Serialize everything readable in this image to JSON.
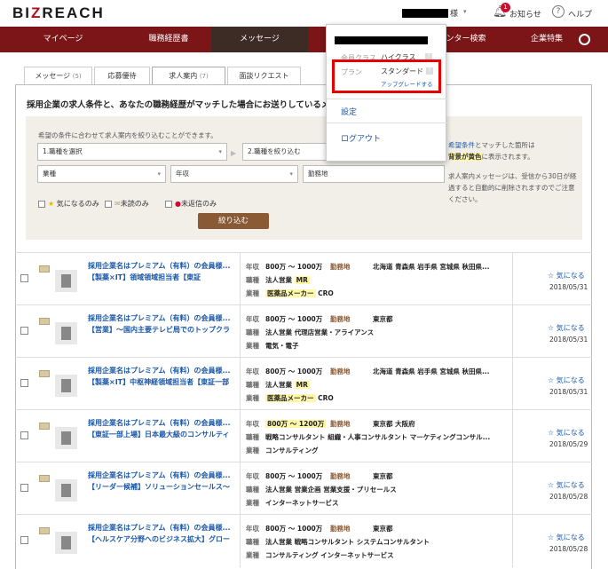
{
  "header": {
    "logo": "BIZREACH",
    "user_suffix": "様",
    "notifications_label": "お知らせ",
    "notifications_count": "1",
    "help_label": "ヘルプ"
  },
  "nav": {
    "items": [
      "マイページ",
      "職務経歴書",
      "メッセージ",
      "",
      "ンター検索",
      "企業特集"
    ],
    "active_index": 2
  },
  "tabs": [
    {
      "label": "メッセージ",
      "count": "(5)"
    },
    {
      "label": "応募優待",
      "count": ""
    },
    {
      "label": "求人案内",
      "count": "(7)"
    },
    {
      "label": "面談リクエスト",
      "count": ""
    }
  ],
  "intro": "採用企業の求人条件と、あなたの職務経歴がマッチした場合にお送りしているメッ",
  "filter": {
    "note": "希望の条件に合わせて求人案内を絞り込むことができます。",
    "select1": "1.職種を選択",
    "select2": "2.職種を絞り込む",
    "select3": "業種",
    "select4": "年収",
    "select5": "勤務地",
    "cb1": "気になるのみ",
    "cb2": "未読のみ",
    "cb3": "未返信のみ",
    "button": "絞り込む",
    "side_a": "希望条件",
    "side_b": "とマッチした箇所は",
    "side_c": "背景が黄色",
    "side_d": "に表示されます。",
    "side_e": "求人案内メッセージは、受信から30日が経過すると自動的に削除されますのでご注意ください。"
  },
  "labels": {
    "salary": "年収",
    "location": "勤務地",
    "job": "職種",
    "industry": "業種",
    "fav": "気になる"
  },
  "rows": [
    {
      "title1": "採用企業名はプレミアム（有料）の会員様...",
      "title2": "【製薬×IT】領域領域担当者【東証",
      "salary": "800万 ～ 1000万",
      "location": "北海道 青森県 岩手県 宮城県 秋田県...",
      "job": "法人営業 ",
      "job_tag": "MR",
      "ind_tag": "医薬品メーカー",
      "ind": " CRO",
      "date": "2018/05/31"
    },
    {
      "title1": "採用企業名はプレミアム（有料）の会員様...",
      "title2": "【営業】～国内主要テレビ局でのトップクラ",
      "salary": "800万 ～ 1000万",
      "location": "東京都",
      "job": "法人営業 代理店営業・アライアンス",
      "job_tag": "",
      "ind_tag": "",
      "ind": "電気・電子",
      "date": "2018/05/31"
    },
    {
      "title1": "採用企業名はプレミアム（有料）の会員様...",
      "title2": "【製薬×IT】中枢神経領域担当者【東証一部",
      "salary": "800万 ～ 1000万",
      "location": "北海道 青森県 岩手県 宮城県 秋田県...",
      "job": "法人営業 ",
      "job_tag": "MR",
      "ind_tag": "医薬品メーカー",
      "ind": " CRO",
      "date": "2018/05/31"
    },
    {
      "title1": "採用企業名はプレミアム（有料）の会員様...",
      "title2": "【東証一部上場】日本最大級のコンサルティ",
      "salary": "800万 ～ 1200万",
      "location": "東京都 大阪府",
      "job": "戦略コンサルタント 組織・人事コンサルタント マーケティングコンサル...",
      "job_tag": "",
      "ind_tag": "",
      "ind": "コンサルティング",
      "date": "2018/05/29",
      "salary_hl": true
    },
    {
      "title1": "採用企業名はプレミアム（有料）の会員様...",
      "title2": "【リーダー候補】ソリューションセールス～",
      "salary": "800万 ～ 1000万",
      "location": "東京都",
      "job": "法人営業 営業企画 営業支援・プリセールス",
      "job_tag": "",
      "ind_tag": "",
      "ind": "インターネットサービス",
      "date": "2018/05/28"
    },
    {
      "title1": "採用企業名はプレミアム（有料）の会員様...",
      "title2": "【ヘルスケア分野へのビジネス拡大】グロー",
      "salary": "800万 ～ 1000万",
      "location": "東京都",
      "job": "法人営業 戦略コンサルタント システムコンサルタント",
      "job_tag": "",
      "ind_tag": "",
      "ind": "コンサルティング インターネットサービス",
      "date": "2018/05/28"
    }
  ],
  "popup": {
    "class_label": "会員クラス",
    "class_value": "ハイクラス",
    "plan_label": "プラン",
    "plan_value": "スタンダード",
    "upgrade": "アップグレードする",
    "settings": "設定",
    "logout": "ログアウト",
    "help_mark": "?"
  },
  "colors": {
    "nav_bg": "#7b1517",
    "nav_active": "#3d2b25",
    "accent_red": "#b30d1c",
    "link": "#1a57a8",
    "highlight": "#fff7a8",
    "highlight_box": "#e60000"
  }
}
